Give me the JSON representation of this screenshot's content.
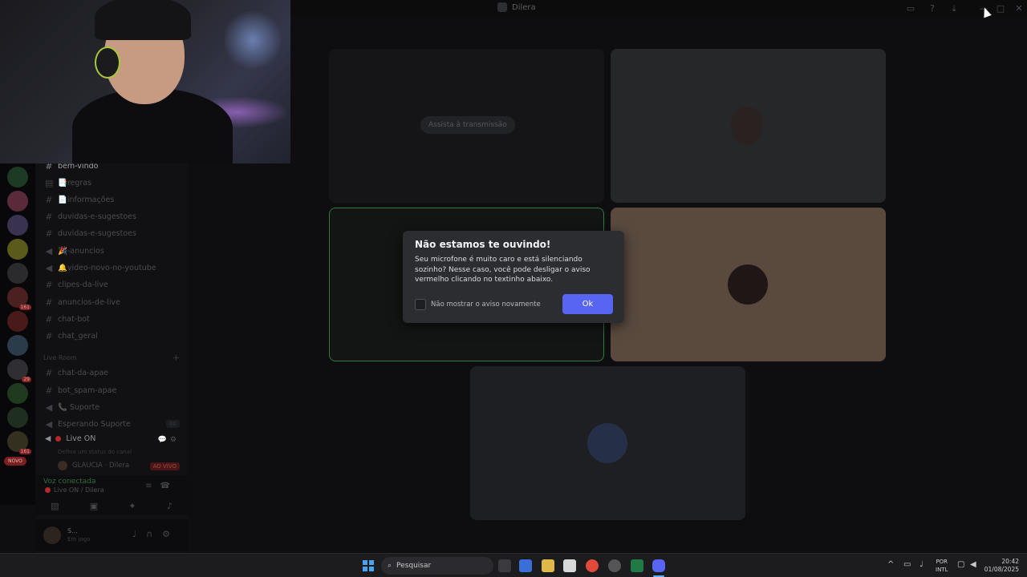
{
  "window": {
    "title": "Dilera"
  },
  "channels": [
    {
      "name": "bem-vindo",
      "icon": "hash-icon"
    },
    {
      "name": "📑regras",
      "icon": "rules-icon"
    },
    {
      "name": "📄informações",
      "icon": "hash-icon"
    },
    {
      "name": "duvidas-e-sugestoes",
      "icon": "hash-icon"
    },
    {
      "name": "duvidas-e-sugestoes",
      "icon": "hash-icon"
    },
    {
      "name": "🎉-anuncios",
      "icon": "megaphone-icon"
    },
    {
      "name": "🔔video-novo-no-youtube",
      "icon": "megaphone-icon"
    },
    {
      "name": "clipes-da-live",
      "icon": "hash-icon"
    },
    {
      "name": "anuncios-de-live",
      "icon": "hash-icon"
    },
    {
      "name": "chat-bot",
      "icon": "hash-icon"
    },
    {
      "name": "chat_geral",
      "icon": "hash-icon"
    }
  ],
  "category": {
    "label": "Live Room"
  },
  "channels2": [
    {
      "name": "chat-da-apae",
      "icon": "hash-icon"
    },
    {
      "name": "bot_spam-apae",
      "icon": "hash-icon"
    },
    {
      "name": "📞 Suporte",
      "icon": "speaker-icon"
    },
    {
      "name": "Esperando Suporte",
      "icon": "speaker-icon"
    }
  ],
  "voice_channel": {
    "name": "Live ON",
    "subtitle": "Defina um status do canal",
    "member": "GLAUCIA · Dilera",
    "live_badge": "AO VIVO"
  },
  "voice_status": {
    "status": "Voz conectada",
    "location": "Live ON / Dilera"
  },
  "user": {
    "name": "S...",
    "status": "Em jogo"
  },
  "server_badges": {
    "novo": "NOVO",
    "b1": "161",
    "b2": "29",
    "b3": "161"
  },
  "stream_tile": {
    "button": "Assista à transmissão"
  },
  "dialog": {
    "title": "Não estamos te ouvindo!",
    "body": "Seu microfone é muito caro e está silenciando sozinho? Nesse caso, você pode desligar o aviso vermelho clicando no textinho abaixo.",
    "checkbox_label": "Não mostrar o aviso novamente",
    "ok_label": "Ok"
  },
  "taskbar": {
    "search_placeholder": "Pesquisar",
    "lang_line1": "POR",
    "lang_line2": "INTL",
    "time": "20:42",
    "date": "01/08/2025",
    "discord_badge": "62"
  },
  "colors": {
    "accent": "#5865f2",
    "dialog_bg": "#2b2d31",
    "speaking_border": "#2f7a3f",
    "live_red": "#b22a2a"
  }
}
